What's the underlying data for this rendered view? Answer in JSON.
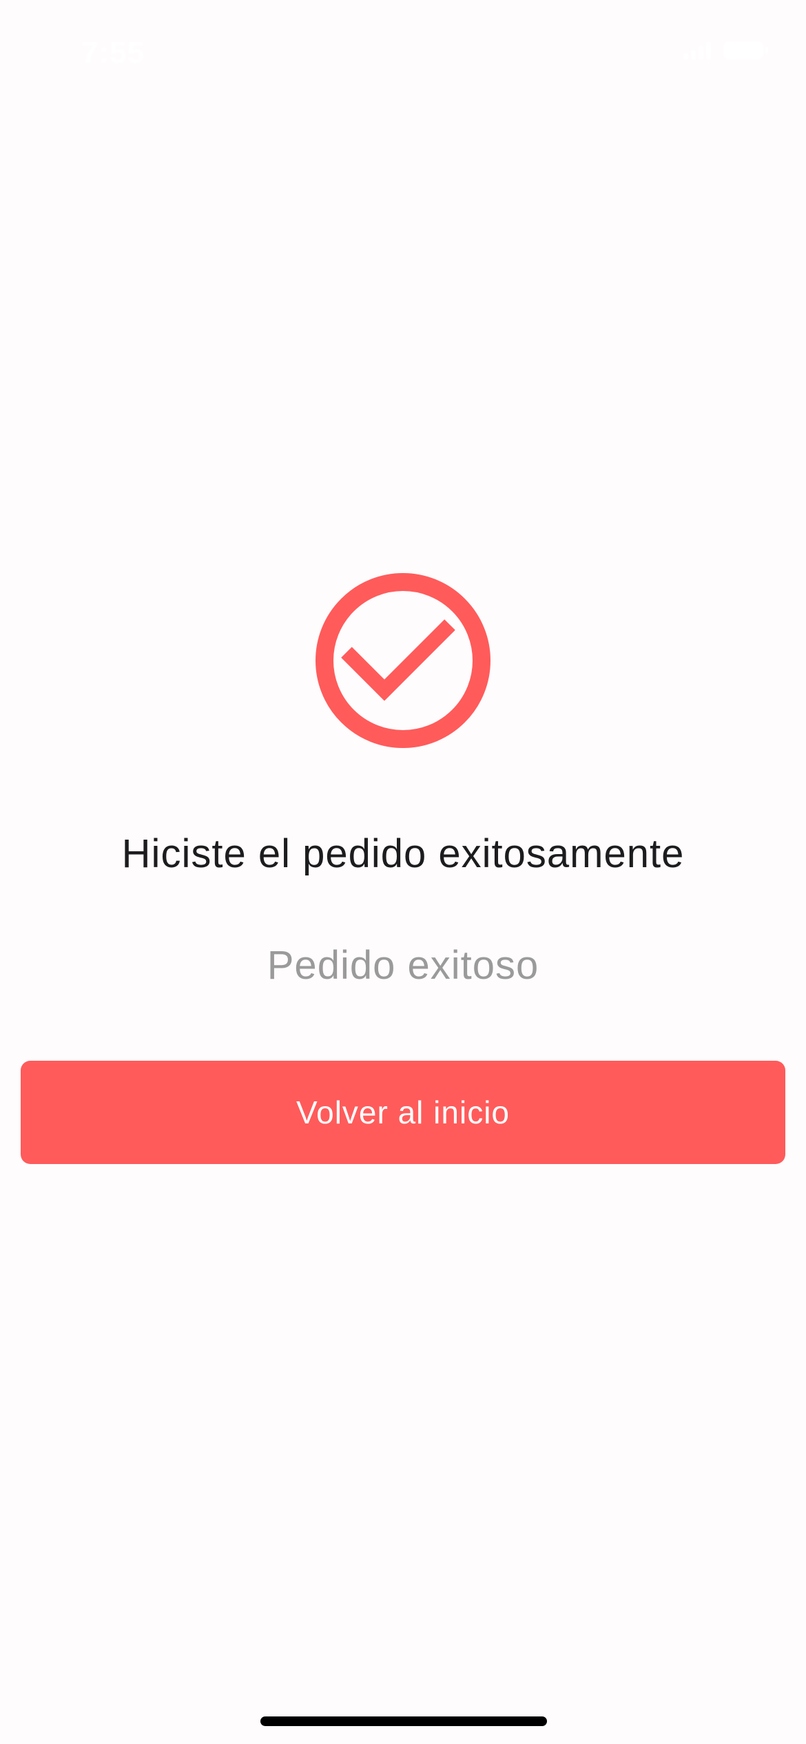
{
  "status_bar": {
    "time": "7:55"
  },
  "icons": {
    "success": "check-circle-icon",
    "signal": "signal-icon",
    "battery": "battery-icon"
  },
  "colors": {
    "accent": "#ff5b5b",
    "background": "#fffcfd",
    "title_text": "#1c1c1e",
    "subtitle_text": "#9a9a9a"
  },
  "content": {
    "title": "Hiciste el pedido exitosamente",
    "subtitle": "Pedido exitoso"
  },
  "actions": {
    "home_button_label": "Volver al inicio"
  }
}
